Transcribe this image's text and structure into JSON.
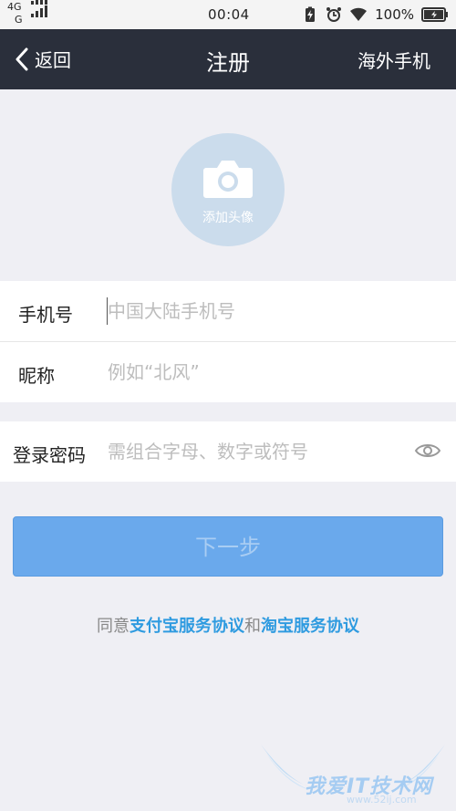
{
  "status_bar": {
    "network_top": "4G",
    "network_bottom": "G",
    "time": "00:04",
    "battery": "100%"
  },
  "nav": {
    "back_label": "返回",
    "title": "注册",
    "right_label": "海外手机"
  },
  "avatar": {
    "label": "添加头像"
  },
  "form": {
    "phone": {
      "label": "手机号",
      "placeholder": "中国大陆手机号",
      "value": ""
    },
    "nickname": {
      "label": "昵称",
      "placeholder": "例如“北风”",
      "value": ""
    },
    "password": {
      "label": "登录密码",
      "placeholder": "需组合字母、数字或符号",
      "value": ""
    }
  },
  "next_button": {
    "label": "下一步"
  },
  "agreement": {
    "prefix": "同意",
    "link1": "支付宝服务协议",
    "conjunction": "和",
    "link2": "淘宝服务协议"
  },
  "watermark": {
    "text": "我爱IT技术网",
    "url": "www.52ij.com"
  },
  "colors": {
    "navbar": "#2a2f3b",
    "button": "#6aa9ec",
    "link": "#2f9be0",
    "avatar": "#cbdcec"
  },
  "icons": [
    "signal-icon",
    "charging-icon",
    "alarm-icon",
    "wifi-icon",
    "battery-icon",
    "back-chevron-icon",
    "camera-icon",
    "eye-icon"
  ]
}
